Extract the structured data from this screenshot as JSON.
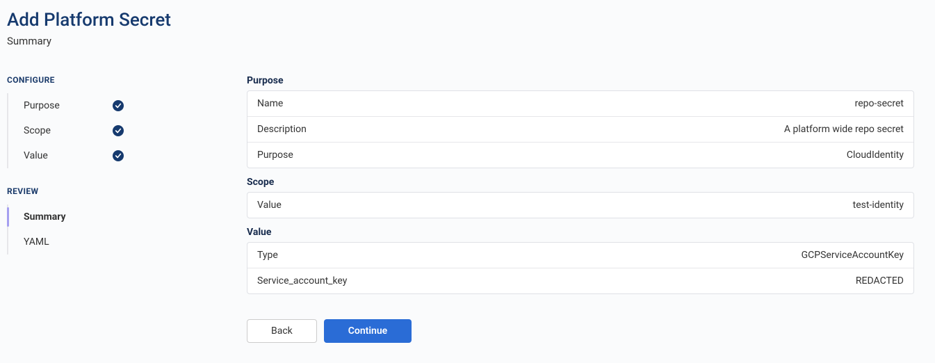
{
  "header": {
    "title": "Add Platform Secret",
    "subtitle": "Summary"
  },
  "sidebar": {
    "configure_label": "CONFIGURE",
    "review_label": "REVIEW",
    "configure_items": [
      {
        "label": "Purpose",
        "done": true
      },
      {
        "label": "Scope",
        "done": true
      },
      {
        "label": "Value",
        "done": true
      }
    ],
    "review_items": [
      {
        "label": "Summary",
        "active": true
      },
      {
        "label": "YAML",
        "active": false
      }
    ]
  },
  "sections": {
    "purpose": {
      "heading": "Purpose",
      "rows": [
        {
          "label": "Name",
          "value": "repo-secret"
        },
        {
          "label": "Description",
          "value": "A platform wide repo secret"
        },
        {
          "label": "Purpose",
          "value": "CloudIdentity"
        }
      ]
    },
    "scope": {
      "heading": "Scope",
      "rows": [
        {
          "label": "Value",
          "value": "test-identity"
        }
      ]
    },
    "value": {
      "heading": "Value",
      "rows": [
        {
          "label": "Type",
          "value": "GCPServiceAccountKey"
        },
        {
          "label": "Service_account_key",
          "value": "REDACTED"
        }
      ]
    }
  },
  "buttons": {
    "back": "Back",
    "continue": "Continue"
  }
}
